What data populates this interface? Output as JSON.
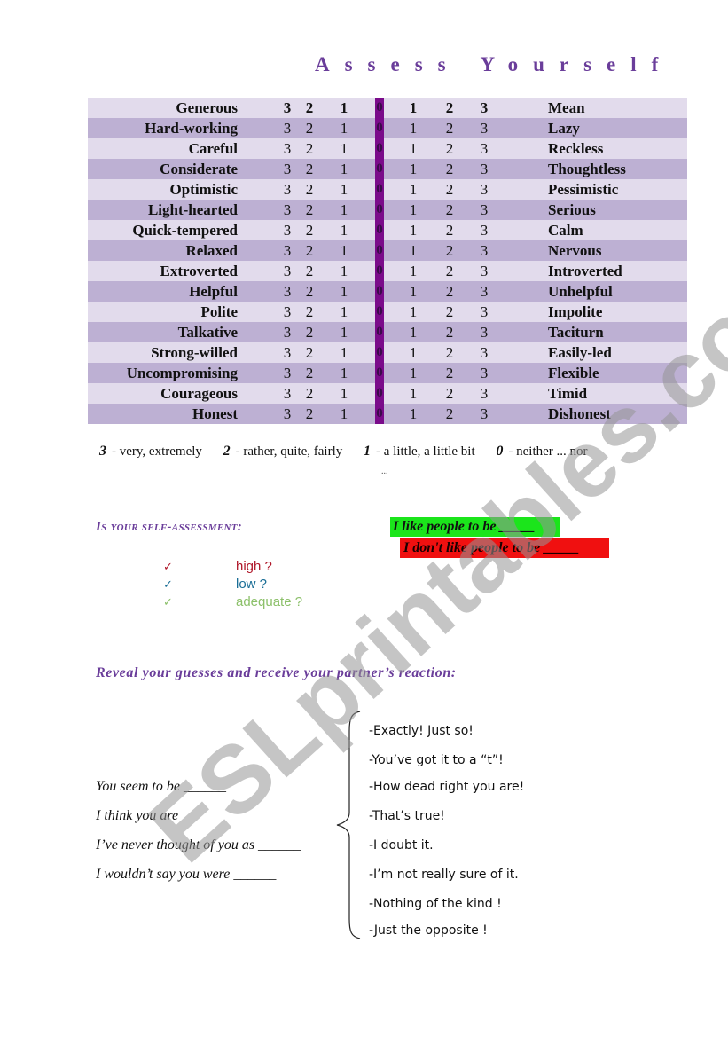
{
  "title": "Assess Yourself",
  "scale": {
    "left_numbers": [
      "3",
      "2",
      "1"
    ],
    "center_number": "0",
    "right_numbers": [
      "1",
      "2",
      "3"
    ],
    "rows": [
      {
        "positive": "Generous",
        "negative": "Mean"
      },
      {
        "positive": "Hard-working",
        "negative": "Lazy"
      },
      {
        "positive": "Careful",
        "negative": "Reckless"
      },
      {
        "positive": "Considerate",
        "negative": "Thoughtless"
      },
      {
        "positive": "Optimistic",
        "negative": "Pessimistic"
      },
      {
        "positive": "Light-hearted",
        "negative": "Serious"
      },
      {
        "positive": "Quick-tempered",
        "negative": "Calm"
      },
      {
        "positive": "Relaxed",
        "negative": "Nervous"
      },
      {
        "positive": "Extroverted",
        "negative": "Introverted"
      },
      {
        "positive": "Helpful",
        "negative": "Unhelpful"
      },
      {
        "positive": "Polite",
        "negative": "Impolite"
      },
      {
        "positive": "Talkative",
        "negative": "Taciturn"
      },
      {
        "positive": "Strong-willed",
        "negative": "Easily-led"
      },
      {
        "positive": "Uncompromising",
        "negative": "Flexible"
      },
      {
        "positive": "Courageous",
        "negative": "Timid"
      },
      {
        "positive": "Honest",
        "negative": "Dishonest"
      }
    ]
  },
  "legend": [
    {
      "key": "3",
      "text": "-  very, extremely"
    },
    {
      "key": "2",
      "text": "-  rather, quite, fairly"
    },
    {
      "key": "1",
      "text": "-  a little, a little bit"
    },
    {
      "key": "0",
      "text": "-  neither ... nor"
    }
  ],
  "legend_continuation": "...",
  "self_assessment": {
    "heading": "Is your self-assessment:",
    "options": [
      {
        "tick": "✓",
        "label": "high ?",
        "color": "#b0182a"
      },
      {
        "tick": "✓",
        "label": "low ?",
        "color": "#1a6e96"
      },
      {
        "tick": "✓",
        "label": "adequate ?",
        "color": "#8cc06a"
      }
    ]
  },
  "like_prompt": "I like people to be _____",
  "dislike_prompt": "I don't like people to be _____",
  "reveal_heading": "Reveal your guesses and receive your partner’s reaction:",
  "prompts": [
    "You seem to be ______",
    "I think you are ______",
    "I’ve never thought of you as ______",
    "I wouldn’t say you  were ______"
  ],
  "reactions": [
    "-Exactly! Just so!",
    "-You’ve got it to a “t”!",
    "-How dead right you are!",
    "-That’s true!",
    "-I doubt it.",
    "-I’m not really sure of it.",
    "-Nothing of the kind !",
    "-Just the opposite !"
  ],
  "watermark": "ESLprintables.com",
  "colors": {
    "title": "#6a3d9a",
    "row_light": "#e2dbec",
    "row_dark": "#bdb0d3",
    "zero_column": "#7a0b8a",
    "like_bg": "#1be51b",
    "dislike_bg": "#f01010"
  }
}
